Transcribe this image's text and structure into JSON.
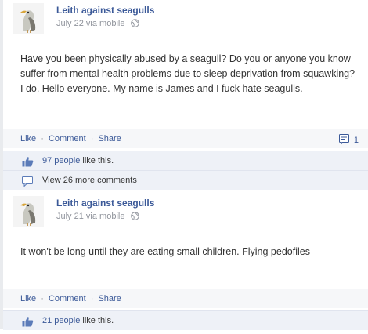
{
  "posts": [
    {
      "author": "Leith against seagulls",
      "date": "July 22",
      "via": "via mobile",
      "text": "Have you been physically abused by a seagull? Do you or anyone you know suffer from mental health problems due to sleep deprivation from squawking? I do. Hello everyone. My name is James and I fuck hate seagulls.",
      "actions": {
        "like": "Like",
        "comment": "Comment",
        "share": "Share",
        "separator": "·"
      },
      "comment_count": "1",
      "likes": {
        "count_text": "97 people",
        "suffix": "like this."
      },
      "view_comments": "View 26 more comments"
    },
    {
      "author": "Leith against seagulls",
      "date": "July 21",
      "via": "via mobile",
      "text": "It won't be long until they are eating small children. Flying pedofiles",
      "actions": {
        "like": "Like",
        "comment": "Comment",
        "share": "Share",
        "separator": "·"
      },
      "likes": {
        "count_text": "21 people",
        "suffix": "like this."
      }
    }
  ],
  "icons": {
    "globe": "globe-icon",
    "thumb": "thumbs-up-icon",
    "comment": "comment-bubble-icon",
    "avatar": "seagull-avatar"
  },
  "colors": {
    "link": "#3b5998",
    "meta": "#90949c",
    "action_bar": "#f6f7f9",
    "ufi_row": "#eef1f7"
  }
}
